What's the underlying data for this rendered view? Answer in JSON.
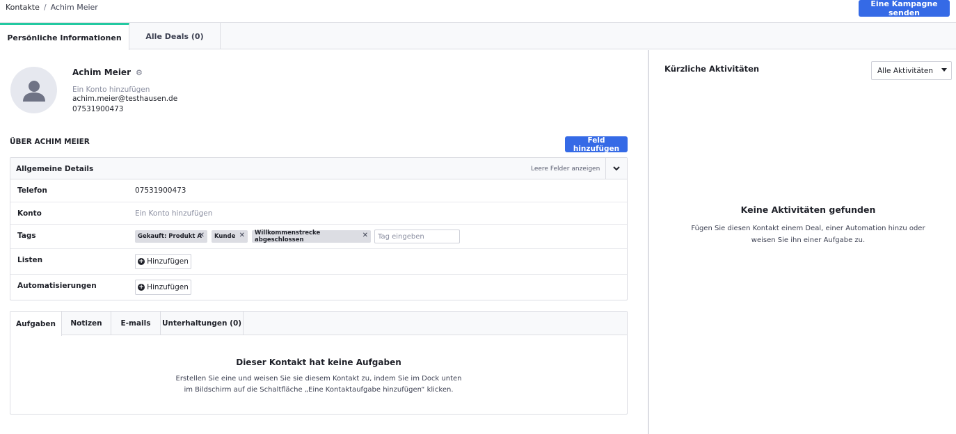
{
  "breadcrumb": {
    "root": "Kontakte",
    "separator": "/",
    "current": "Achim Meier"
  },
  "header": {
    "campaign_button": "Eine Kampagne senden"
  },
  "main_tabs": [
    {
      "label": "Persönliche Informationen",
      "active": true
    },
    {
      "label": "Alle Deals (0)",
      "active": false
    }
  ],
  "contact": {
    "name": "Achim Meier",
    "add_account": "Ein Konto hinzufügen",
    "email": "achim.meier@testhausen.de",
    "phone": "07531900473"
  },
  "about": {
    "title": "ÜBER ACHIM MEIER",
    "add_field_button": "Feld hinzufügen"
  },
  "details": {
    "title": "Allgemeine Details",
    "show_empty": "Leere Felder anzeigen",
    "rows": {
      "phone": {
        "label": "Telefon",
        "value": "07531900473"
      },
      "konto": {
        "label": "Konto",
        "value": "Ein Konto hinzufügen"
      },
      "tags": {
        "label": "Tags",
        "items": [
          "Gekauft: Produkt A",
          "Kunde",
          "Willkommenstrecke abgeschlossen"
        ],
        "input_placeholder": "Tag eingeben"
      },
      "listen": {
        "label": "Listen",
        "button": "Hinzufügen"
      },
      "auto": {
        "label": "Automatisierungen",
        "button": "Hinzufügen"
      }
    }
  },
  "tasks": {
    "tabs": [
      {
        "label": "Aufgaben",
        "active": true
      },
      {
        "label": "Notizen",
        "active": false
      },
      {
        "label": "E-mails",
        "active": false
      },
      {
        "label": "Unterhaltungen (0)",
        "active": false
      }
    ],
    "empty_title": "Dieser Kontakt hat keine Aufgaben",
    "empty_text": "Erstellen Sie eine und weisen Sie sie diesem Kontakt zu, indem Sie im Dock unten im Bildschirm auf die Schaltfläche „Eine Kontaktaufgabe hinzufügen“ klicken."
  },
  "activities": {
    "title": "Kürzliche Aktivitäten",
    "filter_value": "Alle Aktivitäten",
    "empty_title": "Keine Aktivitäten gefunden",
    "empty_text": "Fügen Sie diesen Kontakt einem Deal, einer Automation hinzu oder weisen Sie ihn einer Aufgabe zu."
  },
  "colors": {
    "primary": "#356ae6",
    "active_tab_accent": "#23c9a1",
    "tag_bg": "#dcdde3"
  },
  "icons": [
    "gear-icon",
    "avatar-person-icon",
    "chevron-down-icon",
    "close-icon",
    "plus-circle-icon",
    "caret-down-icon"
  ]
}
